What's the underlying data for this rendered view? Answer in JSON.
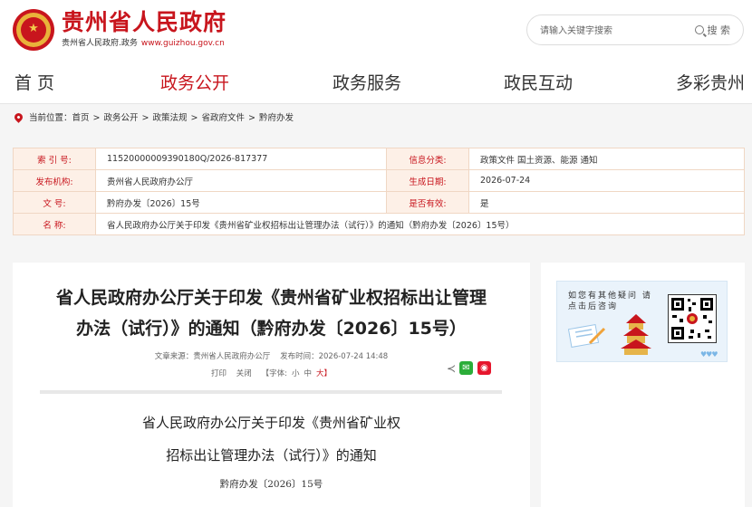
{
  "header": {
    "site_title": "贵州省人民政府",
    "site_subtitle": "贵州省人民政府.政务",
    "site_url": "www.guizhou.gov.cn",
    "emblem_icon": "national-emblem-icon",
    "search": {
      "placeholder": "请输入关键字搜索",
      "button_label": "搜 索",
      "icon": "search-icon"
    }
  },
  "nav": {
    "items": [
      {
        "label": "首 页"
      },
      {
        "label": "政务公开"
      },
      {
        "label": "政务服务"
      },
      {
        "label": "政民互动"
      },
      {
        "label": "多彩贵州"
      }
    ],
    "active_index": 1
  },
  "breadcrumb": {
    "prefix": "当前位置：",
    "items": [
      "首页",
      "政务公开",
      "政策法规",
      "省政府文件",
      "黔府办发"
    ],
    "separator": ">"
  },
  "meta_table": {
    "index_no": {
      "label": "索 引 号:",
      "value": "11520000009390180Q/2026-817377"
    },
    "category": {
      "label": "信息分类:",
      "value": "政策文件    国土资源、能源    通知"
    },
    "issuer": {
      "label": "发布机构:",
      "value": "贵州省人民政府办公厅"
    },
    "created_date": {
      "label": "生成日期:",
      "value": "2026-07-24"
    },
    "doc_no": {
      "label": "文    号:",
      "value": "黔府办发〔2026〕15号"
    },
    "valid": {
      "label": "是否有效:",
      "value": "是"
    },
    "name": {
      "label": "名    称:",
      "value": "省人民政府办公厅关于印发《贵州省矿业权招标出让管理办法（试行）》的通知（黔府办发〔2026〕15号）"
    }
  },
  "article": {
    "title_line1": "省人民政府办公厅关于印发《贵州省矿业权招标出让管理",
    "title_line2": "办法（试行）》的通知（黔府办发〔2026〕15号）",
    "source": "文章来源：贵州省人民政府办公厅",
    "publish_time": "发布时间：2026-07-24 14:48",
    "print_label": "打印",
    "close_label": "关闭",
    "font_label": "【字体:",
    "font_small": "小",
    "font_medium": "中",
    "font_large": "大】",
    "body_title_line1": "省人民政府办公厅关于印发《贵州省矿业权",
    "body_title_line2": "招标出让管理办法（试行）》的通知",
    "body_docno": "黔府办发〔2026〕15号"
  },
  "sidebar": {
    "qa_text": "如您有其他疑问 请点击后咨询",
    "qr_icon": "qr-code-icon"
  },
  "colors": {
    "brand_red": "#c8151d",
    "table_key_bg": "#fdf0e7",
    "table_border": "#f0d7c4"
  }
}
